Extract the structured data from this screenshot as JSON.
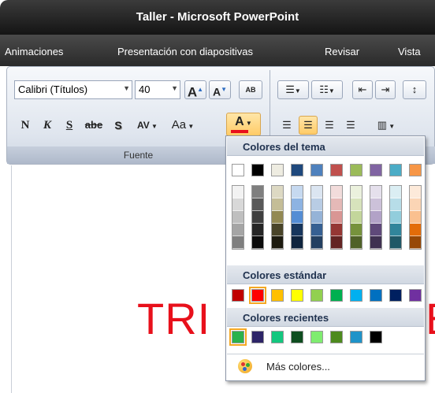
{
  "window": {
    "title": "Taller - Microsoft PowerPoint"
  },
  "tabs": [
    {
      "label": "Animaciones"
    },
    {
      "label": "Presentación con diapositivas"
    },
    {
      "label": "Revisar"
    },
    {
      "label": "Vista"
    }
  ],
  "ribbon": {
    "font_name": "Calibri (Títulos)",
    "font_size": "40",
    "grow_label": "A",
    "shrink_label": "A",
    "clear_label": "AB",
    "bold_label": "N",
    "italic_label": "K",
    "underline_label": "S",
    "strike_label": "abe",
    "shadow_label": "S",
    "spacing_label": "AV",
    "case_label": "Aa",
    "font_color_label": "A",
    "group_label": "Fuente"
  },
  "slide": {
    "title_fragment_left": "TRI",
    "title_fragment_right": "E"
  },
  "palette": {
    "theme_header": "Colores del tema",
    "standard_header": "Colores estándar",
    "recent_header": "Colores recientes",
    "more_label": "Más colores...",
    "theme_top": [
      "#ffffff",
      "#000000",
      "#eeece1",
      "#1f497d",
      "#4f81bd",
      "#c0504d",
      "#9bbb59",
      "#8064a2",
      "#4bacc6",
      "#f79646"
    ],
    "theme_shades": [
      [
        "#f2f2f2",
        "#d8d8d8",
        "#bfbfbf",
        "#a5a5a5",
        "#7f7f7f"
      ],
      [
        "#7f7f7f",
        "#595959",
        "#3f3f3f",
        "#262626",
        "#0c0c0c"
      ],
      [
        "#ddd9c3",
        "#c4bd97",
        "#938953",
        "#494429",
        "#1d1b10"
      ],
      [
        "#c6d9f0",
        "#8db3e2",
        "#548dd4",
        "#17365d",
        "#0f243e"
      ],
      [
        "#dbe5f1",
        "#b8cce4",
        "#95b3d7",
        "#366092",
        "#244061"
      ],
      [
        "#f2dcdb",
        "#e5b9b7",
        "#d99694",
        "#953734",
        "#632423"
      ],
      [
        "#ebf1dd",
        "#d7e3bc",
        "#c3d69b",
        "#76923c",
        "#4f6128"
      ],
      [
        "#e5e0ec",
        "#ccc1d9",
        "#b2a2c7",
        "#5f497a",
        "#3f3151"
      ],
      [
        "#dbeef3",
        "#b7dde8",
        "#92cddc",
        "#31859b",
        "#205867"
      ],
      [
        "#fdeada",
        "#fbd5b5",
        "#fac08f",
        "#e36c09",
        "#974806"
      ]
    ],
    "standard": [
      "#c00000",
      "#ff0000",
      "#ffc000",
      "#ffff00",
      "#92d050",
      "#00b050",
      "#00b0f0",
      "#0070c0",
      "#002060",
      "#7030a0"
    ],
    "recent": [
      "#2bb24c",
      "#2d2467",
      "#14c77f",
      "#0e4d1f",
      "#7fec70",
      "#4d8a1e",
      "#1f93c9",
      "#000000"
    ]
  },
  "colors": {
    "font_color_bar": "#e8101b",
    "slide_text": "#e8101b"
  }
}
